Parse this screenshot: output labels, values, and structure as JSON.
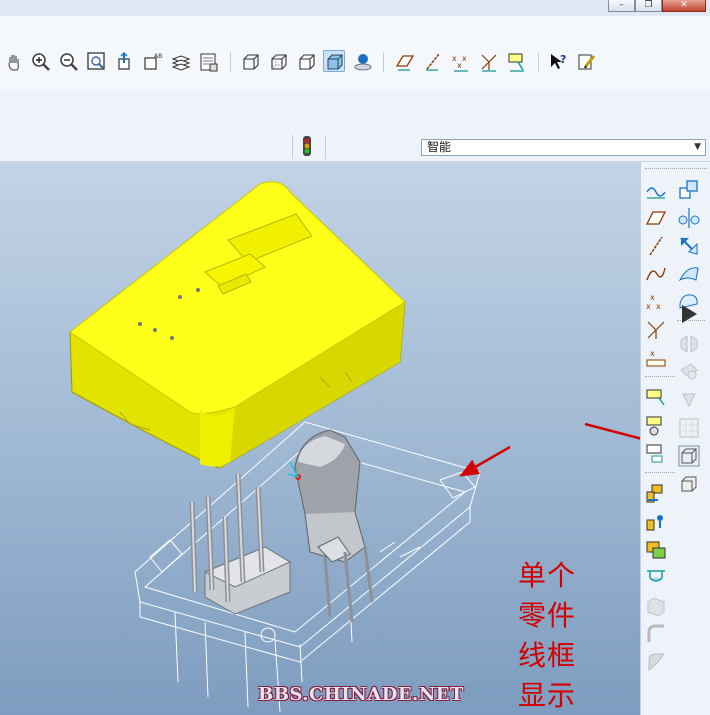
{
  "window": {
    "min_symbol": "–",
    "max_symbol": "❐",
    "close_symbol": "✕"
  },
  "toolbar": {
    "view_icons": [
      "pan-icon",
      "zoom-in-icon",
      "zoom-out-icon",
      "zoom-fit-icon",
      "reorient-icon",
      "saved-views-icon",
      "layers-icon",
      "model-tree-icon"
    ],
    "display_style_icons": [
      "wireframe-icon",
      "hidden-line-icon",
      "no-hidden-icon",
      "shading-icon",
      "appearance-icon"
    ],
    "datum_icons": [
      "datum-planes-icon",
      "datum-axes-icon",
      "datum-points-icon",
      "coordinate-systems-icon",
      "annotations-icon"
    ],
    "help_icons": [
      "whats-this-help-icon",
      "annotation-tool-icon"
    ],
    "active_display_style": "shading-icon"
  },
  "status": {
    "traffic_light_icon": "regenerate-status-icon"
  },
  "filter": {
    "value": "智能"
  },
  "viewport": {
    "annotation_lines": [
      "单个",
      "零件",
      "线框",
      "显示"
    ],
    "watermark": "BBS.CHINADE.NET",
    "colors": {
      "part_yellow": "#ffff00",
      "annotation_red": "#d40000",
      "wireframe_white": "#ffffff"
    }
  },
  "right_toolbar": {
    "left_column": [
      "sketched-curve-icon",
      "datum-plane-icon",
      "datum-axis-icon",
      "datum-curve-icon",
      "datum-point-icon",
      "datum-csys-icon",
      "sketch-icon",
      "datum-analysis-icon",
      "feature-insert-icon",
      "tool-flip-icon",
      "tool-group-icon",
      "assemble-icon",
      "create-component-icon",
      "package-icon",
      "mold-component-icon",
      "round-icon",
      "shell-icon",
      "draft-icon"
    ],
    "right_column": [
      "copy-icon",
      "mirror-icon",
      "move-icon",
      "surface-icon",
      "boundary-icon",
      "split-icon",
      "offset-icon",
      "cut-icon",
      "pattern-icon",
      "wireframe-part-icon",
      "solid-display-icon"
    ]
  }
}
